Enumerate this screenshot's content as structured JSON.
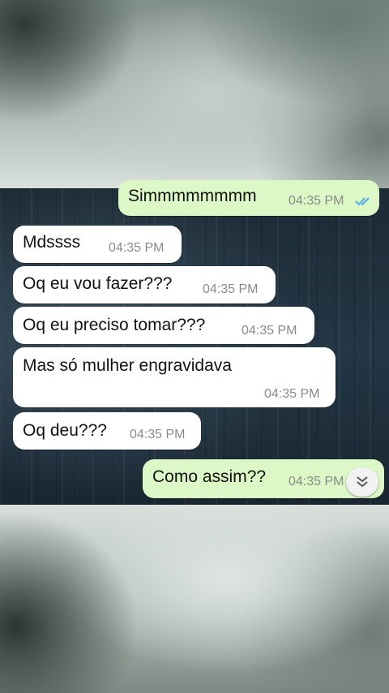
{
  "messages": [
    {
      "text": "Simmmmmmmm",
      "time": "04:35 PM",
      "direction": "outgoing",
      "status": "read"
    },
    {
      "text": "Mdssss",
      "time": "04:35 PM",
      "direction": "incoming"
    },
    {
      "text": "Oq eu vou fazer???",
      "time": "04:35 PM",
      "direction": "incoming"
    },
    {
      "text": "Oq eu preciso tomar???",
      "time": "04:35 PM",
      "direction": "incoming"
    },
    {
      "text": "Mas só mulher engravidava",
      "time": "04:35 PM",
      "direction": "incoming"
    },
    {
      "text": "Oq deu???",
      "time": "04:35 PM",
      "direction": "incoming"
    },
    {
      "text": "Como assim??",
      "time": "04:35 PM",
      "direction": "outgoing"
    }
  ],
  "icons": {
    "read_ticks": "double-check-icon",
    "scroll_down": "double-chevron-down-icon"
  },
  "colors": {
    "incoming_bubble": "#ffffff",
    "outgoing_bubble": "#dcf8c6",
    "read_ticks": "#4fa8e8"
  }
}
